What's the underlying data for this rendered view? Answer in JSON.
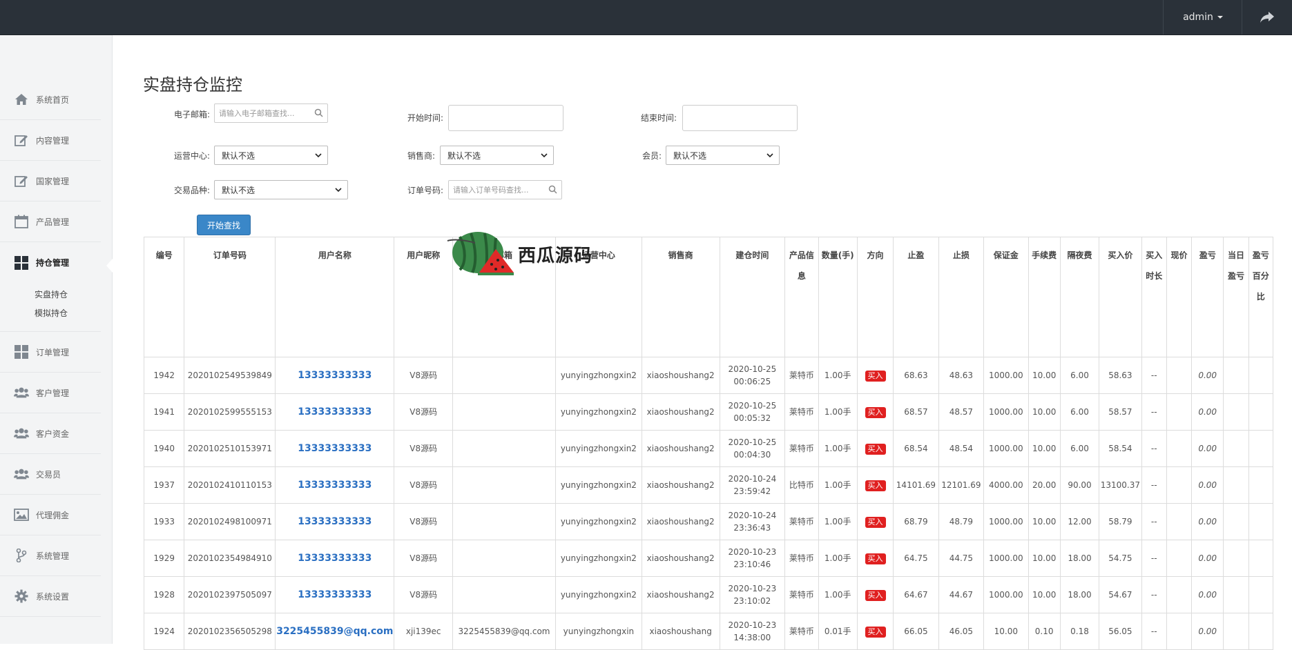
{
  "header": {
    "user": "admin"
  },
  "sidebar": {
    "items": [
      {
        "label": "系统首页",
        "icon": "home-icon"
      },
      {
        "label": "内容管理",
        "icon": "edit-icon"
      },
      {
        "label": "国家管理",
        "icon": "edit-icon"
      },
      {
        "label": "产品管理",
        "icon": "calendar-icon"
      },
      {
        "label": "持仓管理",
        "icon": "grid-icon",
        "active": true,
        "sub": [
          "实盘持仓",
          "模拟持仓"
        ]
      },
      {
        "label": "订单管理",
        "icon": "grid-icon"
      },
      {
        "label": "客户管理",
        "icon": "users-icon"
      },
      {
        "label": "客户资金",
        "icon": "users-icon"
      },
      {
        "label": "交易员",
        "icon": "users-icon"
      },
      {
        "label": "代理佣金",
        "icon": "image-icon"
      },
      {
        "label": "系统管理",
        "icon": "branch-icon"
      },
      {
        "label": "系统设置",
        "icon": "gear-icon"
      }
    ]
  },
  "page": {
    "title": "实盘持仓监控"
  },
  "filters": {
    "email_label": "电子邮箱:",
    "email_placeholder": "请输入电子邮箱查找...",
    "start_label": "开始时间:",
    "end_label": "结束时间:",
    "ops_label": "运营中心:",
    "seller_label": "销售商:",
    "member_label": "会员:",
    "product_label": "交易品种:",
    "order_label": "订单号码:",
    "order_placeholder": "请输入订单号码查找...",
    "default_option": "默认不选",
    "search_button": "开始查找"
  },
  "watermark": "西瓜源码",
  "table": {
    "headers": [
      "编号",
      "订单号码",
      "用户名称",
      "用户昵称",
      "邮箱",
      "运营中心",
      "销售商",
      "建仓时间",
      "产品信息",
      "数量(手)",
      "方向",
      "止盈",
      "止损",
      "保证金",
      "手续费",
      "隔夜费",
      "买入价",
      "买入时长",
      "现价",
      "盈亏",
      "当日盈亏",
      "盈亏百分比"
    ],
    "rows": [
      {
        "id": "1942",
        "order": "2020102549539849",
        "user": "13333333333",
        "nick": "V8源码",
        "email": "",
        "ops": "yunyingzhongxin2",
        "seller": "xiaoshoushang2",
        "date": "2020-10-25",
        "time": "00:06:25",
        "product": "莱特币",
        "qty": "1.00手",
        "dir": "买入",
        "tp": "68.63",
        "sl": "48.63",
        "margin": "1000.00",
        "fee": "10.00",
        "overnight": "6.00",
        "price": "58.63",
        "duration": "--",
        "current": "",
        "pnl": "0.00"
      },
      {
        "id": "1941",
        "order": "2020102599555153",
        "user": "13333333333",
        "nick": "V8源码",
        "email": "",
        "ops": "yunyingzhongxin2",
        "seller": "xiaoshoushang2",
        "date": "2020-10-25",
        "time": "00:05:32",
        "product": "莱特币",
        "qty": "1.00手",
        "dir": "买入",
        "tp": "68.57",
        "sl": "48.57",
        "margin": "1000.00",
        "fee": "10.00",
        "overnight": "6.00",
        "price": "58.57",
        "duration": "--",
        "current": "",
        "pnl": "0.00"
      },
      {
        "id": "1940",
        "order": "2020102510153971",
        "user": "13333333333",
        "nick": "V8源码",
        "email": "",
        "ops": "yunyingzhongxin2",
        "seller": "xiaoshoushang2",
        "date": "2020-10-25",
        "time": "00:04:30",
        "product": "莱特币",
        "qty": "1.00手",
        "dir": "买入",
        "tp": "68.54",
        "sl": "48.54",
        "margin": "1000.00",
        "fee": "10.00",
        "overnight": "6.00",
        "price": "58.54",
        "duration": "--",
        "current": "",
        "pnl": "0.00"
      },
      {
        "id": "1937",
        "order": "2020102410110153",
        "user": "13333333333",
        "nick": "V8源码",
        "email": "",
        "ops": "yunyingzhongxin2",
        "seller": "xiaoshoushang2",
        "date": "2020-10-24",
        "time": "23:59:42",
        "product": "比特币",
        "qty": "1.00手",
        "dir": "买入",
        "tp": "14101.69",
        "sl": "12101.69",
        "margin": "4000.00",
        "fee": "20.00",
        "overnight": "90.00",
        "price": "13100.37",
        "duration": "--",
        "current": "",
        "pnl": "0.00"
      },
      {
        "id": "1933",
        "order": "2020102498100971",
        "user": "13333333333",
        "nick": "V8源码",
        "email": "",
        "ops": "yunyingzhongxin2",
        "seller": "xiaoshoushang2",
        "date": "2020-10-24",
        "time": "23:36:43",
        "product": "莱特币",
        "qty": "1.00手",
        "dir": "买入",
        "tp": "68.79",
        "sl": "48.79",
        "margin": "1000.00",
        "fee": "10.00",
        "overnight": "12.00",
        "price": "58.79",
        "duration": "--",
        "current": "",
        "pnl": "0.00"
      },
      {
        "id": "1929",
        "order": "2020102354984910",
        "user": "13333333333",
        "nick": "V8源码",
        "email": "",
        "ops": "yunyingzhongxin2",
        "seller": "xiaoshoushang2",
        "date": "2020-10-23",
        "time": "23:10:46",
        "product": "莱特币",
        "qty": "1.00手",
        "dir": "买入",
        "tp": "64.75",
        "sl": "44.75",
        "margin": "1000.00",
        "fee": "10.00",
        "overnight": "18.00",
        "price": "54.75",
        "duration": "--",
        "current": "",
        "pnl": "0.00"
      },
      {
        "id": "1928",
        "order": "2020102397505097",
        "user": "13333333333",
        "nick": "V8源码",
        "email": "",
        "ops": "yunyingzhongxin2",
        "seller": "xiaoshoushang2",
        "date": "2020-10-23",
        "time": "23:10:02",
        "product": "莱特币",
        "qty": "1.00手",
        "dir": "买入",
        "tp": "64.67",
        "sl": "44.67",
        "margin": "1000.00",
        "fee": "10.00",
        "overnight": "18.00",
        "price": "54.67",
        "duration": "--",
        "current": "",
        "pnl": "0.00"
      },
      {
        "id": "1924",
        "order": "2020102356505298",
        "user": "3225455839@qq.com",
        "nick": "xji139ec",
        "email": "3225455839@qq.com",
        "ops": "yunyingzhongxin",
        "seller": "xiaoshoushang",
        "date": "2020-10-23",
        "time": "14:38:00",
        "product": "莱特币",
        "qty": "0.01手",
        "dir": "买入",
        "tp": "66.05",
        "sl": "46.05",
        "margin": "10.00",
        "fee": "0.10",
        "overnight": "0.18",
        "price": "56.05",
        "duration": "--",
        "current": "",
        "pnl": "0.00"
      }
    ]
  },
  "colors": {
    "topbar": "#2a3139",
    "sidebar": "#f3f4f5",
    "link": "#2a6fc2",
    "buy": "#e02020",
    "button": "#3a87c8"
  }
}
